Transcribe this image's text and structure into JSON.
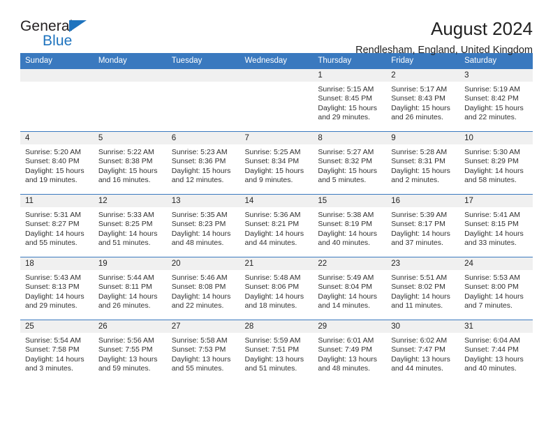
{
  "brand": {
    "name_part1": "General",
    "name_part2": "Blue",
    "flag_icon": "triangle-flag-icon",
    "accent_color": "#1e73be"
  },
  "header": {
    "title": "August 2024",
    "subtitle": "Rendlesham, England, United Kingdom"
  },
  "theme": {
    "header_row_color": "#3a79bf",
    "daynum_band_color": "#f0f0f0",
    "text_color": "#303030"
  },
  "calendar": {
    "weekday_headers": [
      "Sunday",
      "Monday",
      "Tuesday",
      "Wednesday",
      "Thursday",
      "Friday",
      "Saturday"
    ],
    "weeks": [
      [
        {
          "day": "",
          "lines": [
            "",
            "",
            "",
            ""
          ],
          "empty": true
        },
        {
          "day": "",
          "lines": [
            "",
            "",
            "",
            ""
          ],
          "empty": true
        },
        {
          "day": "",
          "lines": [
            "",
            "",
            "",
            ""
          ],
          "empty": true
        },
        {
          "day": "",
          "lines": [
            "",
            "",
            "",
            ""
          ],
          "empty": true
        },
        {
          "day": "1",
          "lines": [
            "Sunrise: 5:15 AM",
            "Sunset: 8:45 PM",
            "Daylight: 15 hours",
            "and 29 minutes."
          ],
          "empty": false
        },
        {
          "day": "2",
          "lines": [
            "Sunrise: 5:17 AM",
            "Sunset: 8:43 PM",
            "Daylight: 15 hours",
            "and 26 minutes."
          ],
          "empty": false
        },
        {
          "day": "3",
          "lines": [
            "Sunrise: 5:19 AM",
            "Sunset: 8:42 PM",
            "Daylight: 15 hours",
            "and 22 minutes."
          ],
          "empty": false
        }
      ],
      [
        {
          "day": "4",
          "lines": [
            "Sunrise: 5:20 AM",
            "Sunset: 8:40 PM",
            "Daylight: 15 hours",
            "and 19 minutes."
          ],
          "empty": false
        },
        {
          "day": "5",
          "lines": [
            "Sunrise: 5:22 AM",
            "Sunset: 8:38 PM",
            "Daylight: 15 hours",
            "and 16 minutes."
          ],
          "empty": false
        },
        {
          "day": "6",
          "lines": [
            "Sunrise: 5:23 AM",
            "Sunset: 8:36 PM",
            "Daylight: 15 hours",
            "and 12 minutes."
          ],
          "empty": false
        },
        {
          "day": "7",
          "lines": [
            "Sunrise: 5:25 AM",
            "Sunset: 8:34 PM",
            "Daylight: 15 hours",
            "and 9 minutes."
          ],
          "empty": false
        },
        {
          "day": "8",
          "lines": [
            "Sunrise: 5:27 AM",
            "Sunset: 8:32 PM",
            "Daylight: 15 hours",
            "and 5 minutes."
          ],
          "empty": false
        },
        {
          "day": "9",
          "lines": [
            "Sunrise: 5:28 AM",
            "Sunset: 8:31 PM",
            "Daylight: 15 hours",
            "and 2 minutes."
          ],
          "empty": false
        },
        {
          "day": "10",
          "lines": [
            "Sunrise: 5:30 AM",
            "Sunset: 8:29 PM",
            "Daylight: 14 hours",
            "and 58 minutes."
          ],
          "empty": false
        }
      ],
      [
        {
          "day": "11",
          "lines": [
            "Sunrise: 5:31 AM",
            "Sunset: 8:27 PM",
            "Daylight: 14 hours",
            "and 55 minutes."
          ],
          "empty": false
        },
        {
          "day": "12",
          "lines": [
            "Sunrise: 5:33 AM",
            "Sunset: 8:25 PM",
            "Daylight: 14 hours",
            "and 51 minutes."
          ],
          "empty": false
        },
        {
          "day": "13",
          "lines": [
            "Sunrise: 5:35 AM",
            "Sunset: 8:23 PM",
            "Daylight: 14 hours",
            "and 48 minutes."
          ],
          "empty": false
        },
        {
          "day": "14",
          "lines": [
            "Sunrise: 5:36 AM",
            "Sunset: 8:21 PM",
            "Daylight: 14 hours",
            "and 44 minutes."
          ],
          "empty": false
        },
        {
          "day": "15",
          "lines": [
            "Sunrise: 5:38 AM",
            "Sunset: 8:19 PM",
            "Daylight: 14 hours",
            "and 40 minutes."
          ],
          "empty": false
        },
        {
          "day": "16",
          "lines": [
            "Sunrise: 5:39 AM",
            "Sunset: 8:17 PM",
            "Daylight: 14 hours",
            "and 37 minutes."
          ],
          "empty": false
        },
        {
          "day": "17",
          "lines": [
            "Sunrise: 5:41 AM",
            "Sunset: 8:15 PM",
            "Daylight: 14 hours",
            "and 33 minutes."
          ],
          "empty": false
        }
      ],
      [
        {
          "day": "18",
          "lines": [
            "Sunrise: 5:43 AM",
            "Sunset: 8:13 PM",
            "Daylight: 14 hours",
            "and 29 minutes."
          ],
          "empty": false
        },
        {
          "day": "19",
          "lines": [
            "Sunrise: 5:44 AM",
            "Sunset: 8:11 PM",
            "Daylight: 14 hours",
            "and 26 minutes."
          ],
          "empty": false
        },
        {
          "day": "20",
          "lines": [
            "Sunrise: 5:46 AM",
            "Sunset: 8:08 PM",
            "Daylight: 14 hours",
            "and 22 minutes."
          ],
          "empty": false
        },
        {
          "day": "21",
          "lines": [
            "Sunrise: 5:48 AM",
            "Sunset: 8:06 PM",
            "Daylight: 14 hours",
            "and 18 minutes."
          ],
          "empty": false
        },
        {
          "day": "22",
          "lines": [
            "Sunrise: 5:49 AM",
            "Sunset: 8:04 PM",
            "Daylight: 14 hours",
            "and 14 minutes."
          ],
          "empty": false
        },
        {
          "day": "23",
          "lines": [
            "Sunrise: 5:51 AM",
            "Sunset: 8:02 PM",
            "Daylight: 14 hours",
            "and 11 minutes."
          ],
          "empty": false
        },
        {
          "day": "24",
          "lines": [
            "Sunrise: 5:53 AM",
            "Sunset: 8:00 PM",
            "Daylight: 14 hours",
            "and 7 minutes."
          ],
          "empty": false
        }
      ],
      [
        {
          "day": "25",
          "lines": [
            "Sunrise: 5:54 AM",
            "Sunset: 7:58 PM",
            "Daylight: 14 hours",
            "and 3 minutes."
          ],
          "empty": false
        },
        {
          "day": "26",
          "lines": [
            "Sunrise: 5:56 AM",
            "Sunset: 7:55 PM",
            "Daylight: 13 hours",
            "and 59 minutes."
          ],
          "empty": false
        },
        {
          "day": "27",
          "lines": [
            "Sunrise: 5:58 AM",
            "Sunset: 7:53 PM",
            "Daylight: 13 hours",
            "and 55 minutes."
          ],
          "empty": false
        },
        {
          "day": "28",
          "lines": [
            "Sunrise: 5:59 AM",
            "Sunset: 7:51 PM",
            "Daylight: 13 hours",
            "and 51 minutes."
          ],
          "empty": false
        },
        {
          "day": "29",
          "lines": [
            "Sunrise: 6:01 AM",
            "Sunset: 7:49 PM",
            "Daylight: 13 hours",
            "and 48 minutes."
          ],
          "empty": false
        },
        {
          "day": "30",
          "lines": [
            "Sunrise: 6:02 AM",
            "Sunset: 7:47 PM",
            "Daylight: 13 hours",
            "and 44 minutes."
          ],
          "empty": false
        },
        {
          "day": "31",
          "lines": [
            "Sunrise: 6:04 AM",
            "Sunset: 7:44 PM",
            "Daylight: 13 hours",
            "and 40 minutes."
          ],
          "empty": false
        }
      ]
    ]
  }
}
